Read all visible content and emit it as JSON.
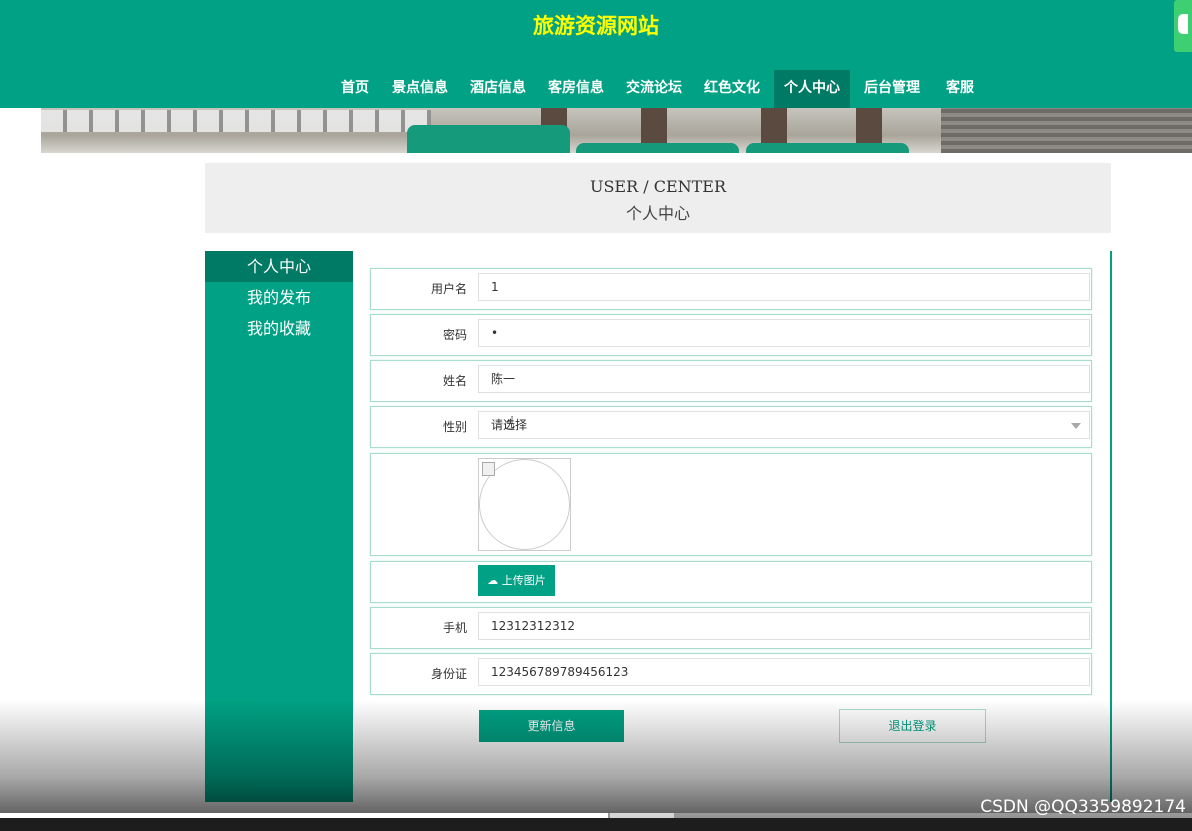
{
  "header": {
    "site_title": "旅游资源网站",
    "nav": [
      {
        "label": "首页"
      },
      {
        "label": "景点信息"
      },
      {
        "label": "酒店信息"
      },
      {
        "label": "客房信息"
      },
      {
        "label": "交流论坛"
      },
      {
        "label": "红色文化"
      },
      {
        "label": "个人中心"
      },
      {
        "label": "后台管理"
      },
      {
        "label": "客服"
      }
    ],
    "active_nav": "个人中心"
  },
  "page_title": {
    "en": "USER / CENTER",
    "cn": "个人中心"
  },
  "sidebar": {
    "items": [
      {
        "label": "个人中心"
      },
      {
        "label": "我的发布"
      },
      {
        "label": "我的收藏"
      }
    ],
    "active": "个人中心"
  },
  "form": {
    "username": {
      "label": "用户名",
      "value": "1"
    },
    "password": {
      "label": "密码",
      "value": "•"
    },
    "name": {
      "label": "姓名",
      "value": "陈一"
    },
    "gender": {
      "label": "性别",
      "value": "请选择"
    },
    "upload_label": "上传图片",
    "phone": {
      "label": "手机",
      "value": "12312312312"
    },
    "id_card": {
      "label": "身份证",
      "value": "123456789789456123"
    }
  },
  "actions": {
    "update": "更新信息",
    "logout": "退出登录"
  },
  "video": {
    "watermark": "CSDN @QQ3359892174",
    "progress_fraction": 0.51
  },
  "colors": {
    "primary": "#00a184",
    "primary_dark": "#007a64",
    "title_yellow": "#ffff00"
  }
}
